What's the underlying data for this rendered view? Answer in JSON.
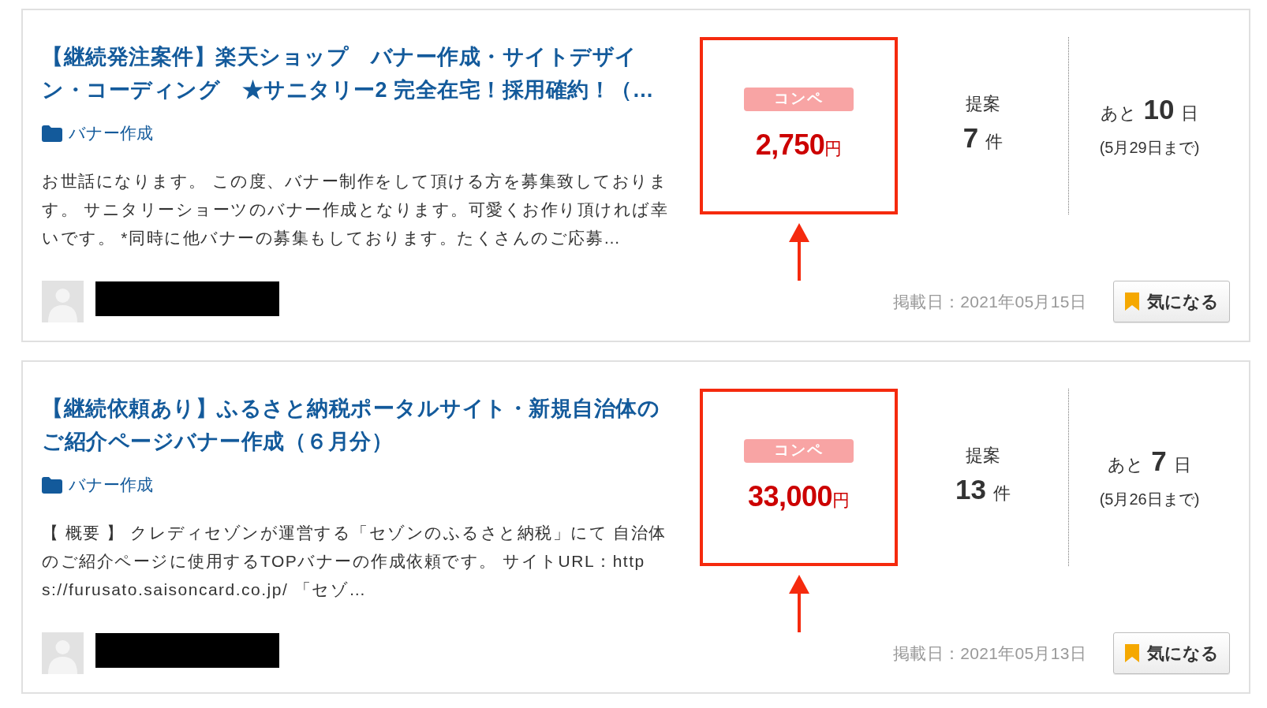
{
  "listings": [
    {
      "title": "【継続発注案件】楽天ショップ　バナー作成・サイトデザイン・コーディング　★サニタリー2 完全在宅！採用確約！（…",
      "category": "バナー作成",
      "description": "お世話になります。 この度、バナー制作をして頂ける方を募集致しております。 サニタリーショーツのバナー作成となります。可愛くお作り頂ければ幸いです。 *同時に他バナーの募集もしております。たくさんのご応募…",
      "contest_badge": "コンペ",
      "price": "2,750",
      "currency": "円",
      "proposals_label": "提案",
      "proposals_count": "7",
      "proposals_unit": "件",
      "remaining_prefix": "あと",
      "remaining_days": "10",
      "remaining_unit": "日",
      "deadline": "(5月29日まで)",
      "posted": "掲載日：2021年05月15日",
      "watch_button": "気になる",
      "highlighted": true
    },
    {
      "title": "【継続依頼あり】ふるさと納税ポータルサイト・新規自治体のご紹介ページバナー作成（６月分）",
      "category": "バナー作成",
      "description": "【 概要 】 クレディセゾンが運営する「セゾンのふるさと納税」にて 自治体のご紹介ページに使用するTOPバナーの作成依頼です。 サイトURL：https://furusato.saisoncard.co.jp/ 「セゾ…",
      "contest_badge": "コンペ",
      "price": "33,000",
      "currency": "円",
      "proposals_label": "提案",
      "proposals_count": "13",
      "proposals_unit": "件",
      "remaining_prefix": "あと",
      "remaining_days": "7",
      "remaining_unit": "日",
      "deadline": "(5月26日まで)",
      "posted": "掲載日：2021年05月13日",
      "watch_button": "気になる",
      "highlighted": true
    }
  ]
}
